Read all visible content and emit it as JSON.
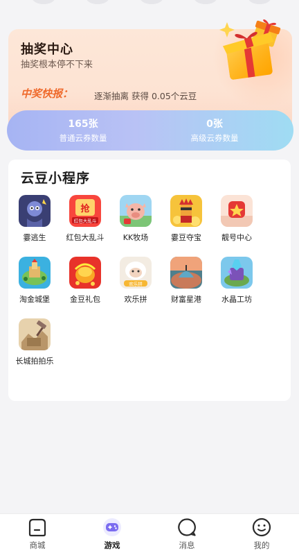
{
  "lottery": {
    "title": "抽奖中心",
    "subtitle": "抽奖根本停不下来",
    "news_label": "中奖快报：",
    "news_text": "逐渐抽离 获得 0.05个云豆",
    "coupons": [
      {
        "count": "165张",
        "label": "普通云券数量"
      },
      {
        "count": "0张",
        "label": "高级云券数量"
      }
    ]
  },
  "mini_programs": {
    "title": "云豆小程序",
    "apps": [
      {
        "name": "霎逃生",
        "icon": "escape-game-icon"
      },
      {
        "name": "红包大乱斗",
        "icon": "red-packet-battle-icon",
        "icon_text": "抢",
        "icon_caption": "红包大乱斗"
      },
      {
        "name": "KK牧场",
        "icon": "kk-ranch-icon"
      },
      {
        "name": "霎豆夺宝",
        "icon": "treasure-hunt-icon"
      },
      {
        "name": "靓号中心",
        "icon": "vip-number-icon"
      },
      {
        "name": "淘金城堡",
        "icon": "gold-castle-icon"
      },
      {
        "name": "金豆礼包",
        "icon": "gold-bean-gift-icon"
      },
      {
        "name": "欢乐拼",
        "icon": "happy-puzzle-icon",
        "icon_caption": "欢乐拼"
      },
      {
        "name": "财富星港",
        "icon": "wealth-star-port-icon"
      },
      {
        "name": "水晶工坊",
        "icon": "crystal-workshop-icon"
      },
      {
        "name": "长城拍拍乐",
        "icon": "great-wall-auction-icon"
      }
    ]
  },
  "nav": {
    "items": [
      {
        "label": "商城",
        "icon": "shop-icon",
        "active": false
      },
      {
        "label": "游戏",
        "icon": "game-icon",
        "active": true
      },
      {
        "label": "消息",
        "icon": "message-icon",
        "active": false
      },
      {
        "label": "我的",
        "icon": "profile-icon",
        "active": false
      }
    ]
  },
  "colors": {
    "accent_orange": "#ef6a2c",
    "coupon_gradient_start": "#a6b4f3",
    "coupon_gradient_end": "#9fdcf3",
    "nav_active": "#7b6cf0"
  }
}
